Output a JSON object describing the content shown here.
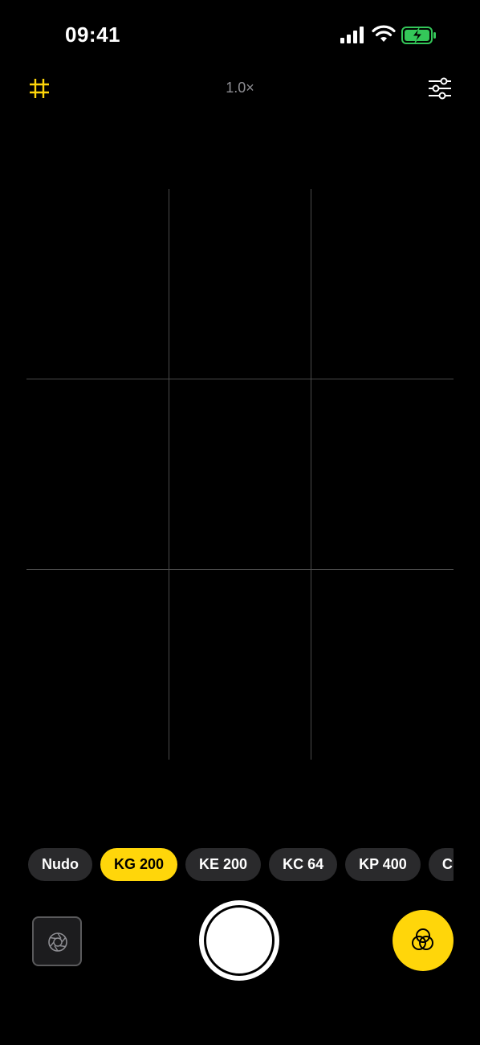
{
  "status_bar": {
    "time": "09:41"
  },
  "top_bar": {
    "zoom": "1.0×"
  },
  "filters": [
    "Nudo",
    "KG 200",
    "KE 200",
    "KC 64",
    "KP 400",
    "C"
  ],
  "selected_filter": "KG 200",
  "colors": {
    "accent": "#ffd60a",
    "chip_bg": "#2a2a2c",
    "background": "#000000",
    "battery": "#34c759"
  },
  "icons": {
    "grid": "grid-hash-icon",
    "settings": "sliders-icon",
    "mode": "aperture-icon",
    "filters": "overlapping-circles-icon"
  }
}
